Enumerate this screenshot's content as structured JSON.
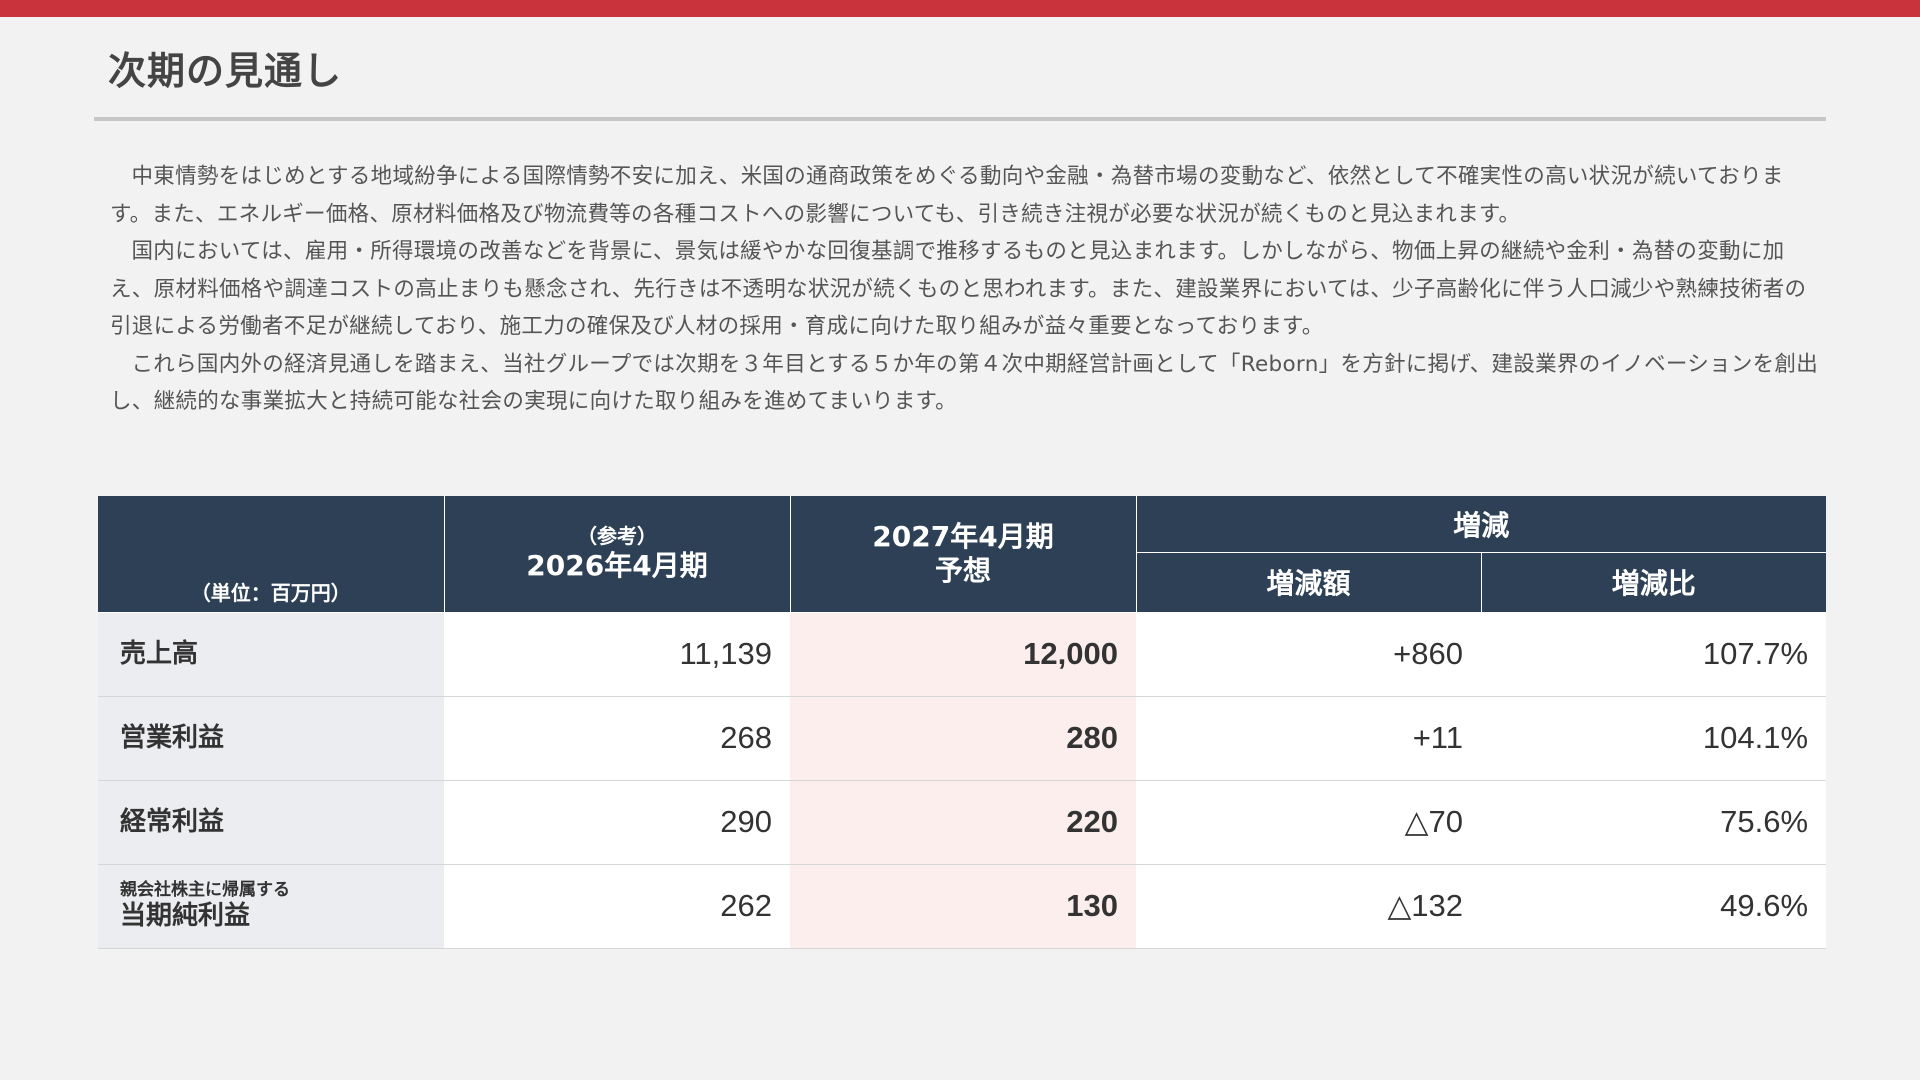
{
  "page": {
    "title": "次期の見通し",
    "accent_color": "#c9333b",
    "header_color": "#2d4056",
    "forecast_highlight_color": "#fdeeee"
  },
  "body": {
    "paragraphs": [
      "中東情勢をはじめとする地域紛争による国際情勢不安に加え、米国の通商政策をめぐる動向や金融・為替市場の変動など、依然として不確実性の高い状況が続いております。また、エネルギー価格、原材料価格及び物流費等の各種コストへの影響についても、引き続き注視が必要な状況が続くものと見込まれます。",
      "国内においては、雇用・所得環境の改善などを背景に、景気は緩やかな回復基調で推移するものと見込まれます。しかしながら、物価上昇の継続や金利・為替の変動に加え、原材料価格や調達コストの高止まりも懸念され、先行きは不透明な状況が続くものと思われます。また、建設業界においては、少子高齢化に伴う人口減少や熟練技術者の引退による労働者不足が継続しており、施工力の確保及び人材の採用・育成に向けた取り組みが益々重要となっております。",
      "これら国内外の経済見通しを踏まえ、当社グループでは次期を３年目とする５か年の第４次中期経営計画として「Reborn」を方針に掲げ、建設業界のイノベーションを創出し、継続的な事業拡大と持続可能な社会の実現に向けた取り組みを進めてまいります。"
    ]
  },
  "table": {
    "unit_label": "（単位：百万円）",
    "col_prev_note": "（参考）",
    "col_prev": "2026年4月期",
    "col_next_line1": "2027年4月期",
    "col_next_line2": "予想",
    "col_change_group": "増減",
    "col_change_amount": "増減額",
    "col_change_ratio": "増減比",
    "rows": [
      {
        "sub_label": "",
        "label": "売上高",
        "prev": "11,139",
        "next": "12,000",
        "change": "+860",
        "ratio": "107.7%"
      },
      {
        "sub_label": "",
        "label": "営業利益",
        "prev": "268",
        "next": "280",
        "change": "+11",
        "ratio": "104.1%"
      },
      {
        "sub_label": "",
        "label": "経常利益",
        "prev": "290",
        "next": "220",
        "change": "△70",
        "ratio": "75.6%"
      },
      {
        "sub_label": "親会社株主に帰属する",
        "label": "当期純利益",
        "prev": "262",
        "next": "130",
        "change": "△132",
        "ratio": "49.6%"
      }
    ]
  }
}
